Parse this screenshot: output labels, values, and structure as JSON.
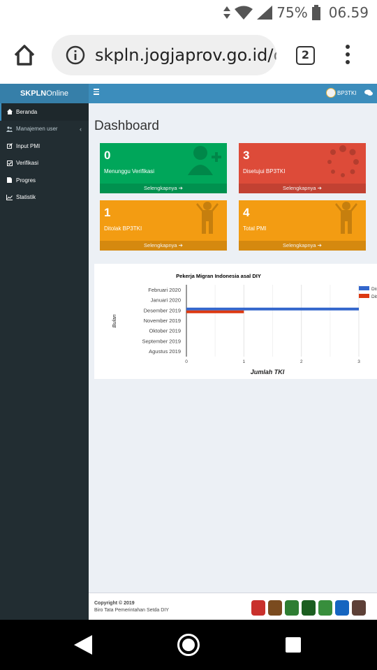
{
  "status_bar": {
    "battery_percent": "75%",
    "time": "06.59"
  },
  "browser": {
    "url": "skpln.jogjaprov.go.id/",
    "url_fade": "c.",
    "tab_count": "2"
  },
  "app": {
    "logo_bold": "SKPLN",
    "logo_light": "Online",
    "user_name": "BP3TKI"
  },
  "sidebar": {
    "items": [
      {
        "label": "Beranda",
        "icon": "home-icon"
      },
      {
        "label": "Manajemen user",
        "icon": "users-icon",
        "caret": "‹"
      },
      {
        "label": "Input PMI",
        "icon": "edit-icon"
      },
      {
        "label": "Verifikasi",
        "icon": "check-square-icon"
      },
      {
        "label": "Progres",
        "icon": "file-icon"
      },
      {
        "label": "Statistik",
        "icon": "line-chart-icon"
      }
    ]
  },
  "main": {
    "page_title": "Dashboard",
    "boxes": [
      {
        "value": "0",
        "label": "Menunggu Verifikasi",
        "link": "Selengkapnya",
        "color": "#00a65a",
        "icon": "user-plus-icon"
      },
      {
        "value": "3",
        "label": "Disetujui BP3TKI",
        "link": "Selengkapnya",
        "color": "#dd4b39",
        "icon": "spinner-icon"
      },
      {
        "value": "1",
        "label": "Ditolak BP3TKI",
        "link": "Selengkapnya",
        "color": "#f39c12",
        "icon": "person-icon"
      },
      {
        "value": "4",
        "label": "Total PMI",
        "link": "Selengkapnya",
        "color": "#f39c12",
        "icon": "person-icon"
      }
    ]
  },
  "chart_data": {
    "type": "bar",
    "orientation": "horizontal",
    "title": "Pekerja Migran Indonesia asal DIY",
    "xlabel": "Jumlah TKI",
    "ylabel": "Bulan",
    "categories": [
      "Februari 2020",
      "Januari 2020",
      "Desember 2019",
      "November 2019",
      "Oktober 2019",
      "September 2019",
      "Agustus 2019"
    ],
    "series": [
      {
        "name": "Dis",
        "color": "#3366cc",
        "values": [
          0,
          0,
          3,
          0,
          0,
          0,
          0
        ]
      },
      {
        "name": "Dit",
        "color": "#dc3912",
        "values": [
          0,
          0,
          1,
          0,
          0,
          0,
          0
        ]
      }
    ],
    "xlim": [
      0,
      3
    ],
    "xticks": [
      "0",
      "1",
      "2",
      "3"
    ],
    "grid": true,
    "legend": "right"
  },
  "footer": {
    "copyright": "Copyright © 2019",
    "org": "Biro Tata Pemerintahan Setda DIY",
    "emblem_colors": [
      "#c9302c",
      "#7a4b1f",
      "#2e7d32",
      "#1b5e20",
      "#388e3c",
      "#1565c0",
      "#5d4037"
    ]
  }
}
